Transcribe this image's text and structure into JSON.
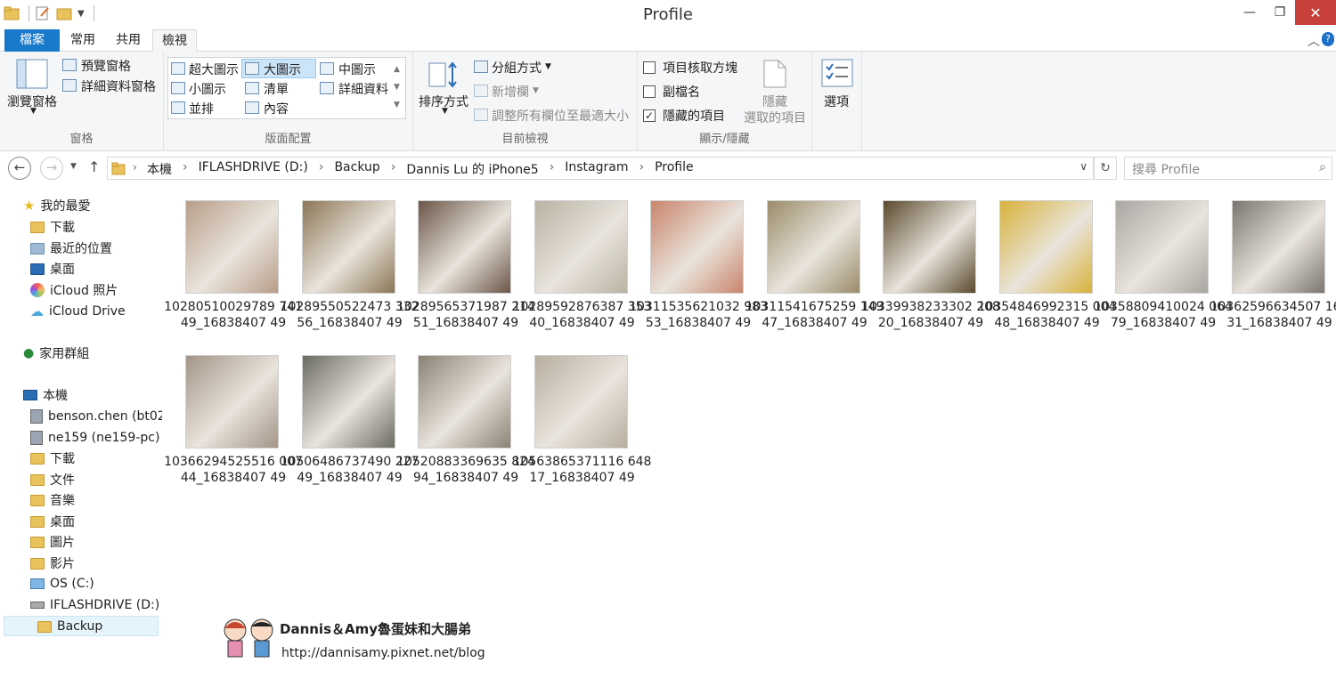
{
  "window": {
    "title": "Profile",
    "minimize": "—",
    "maximize": "❐",
    "close": "✕"
  },
  "ribbon_tabs": [
    "檔案",
    "常用",
    "共用",
    "檢視"
  ],
  "ribbon": {
    "panes": {
      "navigation_pane": "瀏覽窗格",
      "preview_pane": "預覽窗格",
      "details_pane": "詳細資料窗格",
      "group_label": "窗格"
    },
    "layout": {
      "items": [
        "超大圖示",
        "大圖示",
        "中圖示",
        "小圖示",
        "清單",
        "詳細資料",
        "並排",
        "內容"
      ],
      "selected": "大圖示",
      "group_label": "版面配置"
    },
    "current_view": {
      "sort_by": "排序方式",
      "group_by": "分組方式",
      "add_columns": "新增欄",
      "size_columns": "調整所有欄位至最適大小",
      "group_label": "目前檢視"
    },
    "show_hide": {
      "item_checkboxes": "項目核取方塊",
      "file_extensions": "副檔名",
      "hidden_items": "隱藏的項目",
      "hide_selected_1": "隱藏",
      "hide_selected_2": "選取的項目",
      "group_label": "顯示/隱藏"
    },
    "options": "選項"
  },
  "address": {
    "crumbs": [
      "本機",
      "IFLASHDRIVE (D:)",
      "Backup",
      "Dannis Lu 的 iPhone5",
      "Instagram",
      "Profile"
    ],
    "search_placeholder": "搜尋 Profile"
  },
  "nav": {
    "favorites": "我的最愛",
    "downloads": "下載",
    "recent": "最近的位置",
    "desktop": "桌面",
    "icloud_photos": "iCloud 照片",
    "icloud_drive": "iCloud Drive",
    "homegroup": "家用群組",
    "this_pc": "本機",
    "net1": "benson.chen (bt02",
    "net2": "ne159 (ne159-pc)",
    "pc_downloads": "下載",
    "documents": "文件",
    "music": "音樂",
    "pc_desktop": "桌面",
    "pictures": "圖片",
    "videos": "影片",
    "os_drive": "OS (C:)",
    "flash_drive": "IFLASHDRIVE (D:)",
    "backup": "Backup"
  },
  "files": [
    {
      "name": "10280510029789 74149_16838407 49",
      "color": "#b89e8a"
    },
    {
      "name": "10289550522473 33256_16838407 49",
      "color": "#8c7656"
    },
    {
      "name": "10289565371987 21451_16838407 49",
      "color": "#6a5548"
    },
    {
      "name": "10289592876387 35340_16838407 49",
      "color": "#b9b3a4"
    },
    {
      "name": "10311535621032 98353_16838407 49",
      "color": "#c9856d"
    },
    {
      "name": "10311541675259 14947_16838407 49",
      "color": "#9a8c6a"
    },
    {
      "name": "10339938233302 20820_16838407 49",
      "color": "#5a4a2e"
    },
    {
      "name": "10354846992315 00448_16838407 49",
      "color": "#d9b23a"
    },
    {
      "name": "10358809410024 06479_16838407 49",
      "color": "#a9a6a2"
    },
    {
      "name": "10362596634507 16631_16838407 49",
      "color": "#7a756e"
    },
    {
      "name": "10366294525516 00744_16838407 49",
      "color": "#a39488"
    },
    {
      "name": "10506486737490 22749_16838407 49",
      "color": "#6b6b62"
    },
    {
      "name": "10520883369635 82494_16838407 49",
      "color": "#8a8275"
    },
    {
      "name": "10563865371116 64817_16838407 49",
      "color": "#b8aea0"
    }
  ],
  "watermark": {
    "title": "Dannis＆Amy魯蛋妹和大腸弟",
    "url": "http://dannisamy.pixnet.net/blog"
  }
}
